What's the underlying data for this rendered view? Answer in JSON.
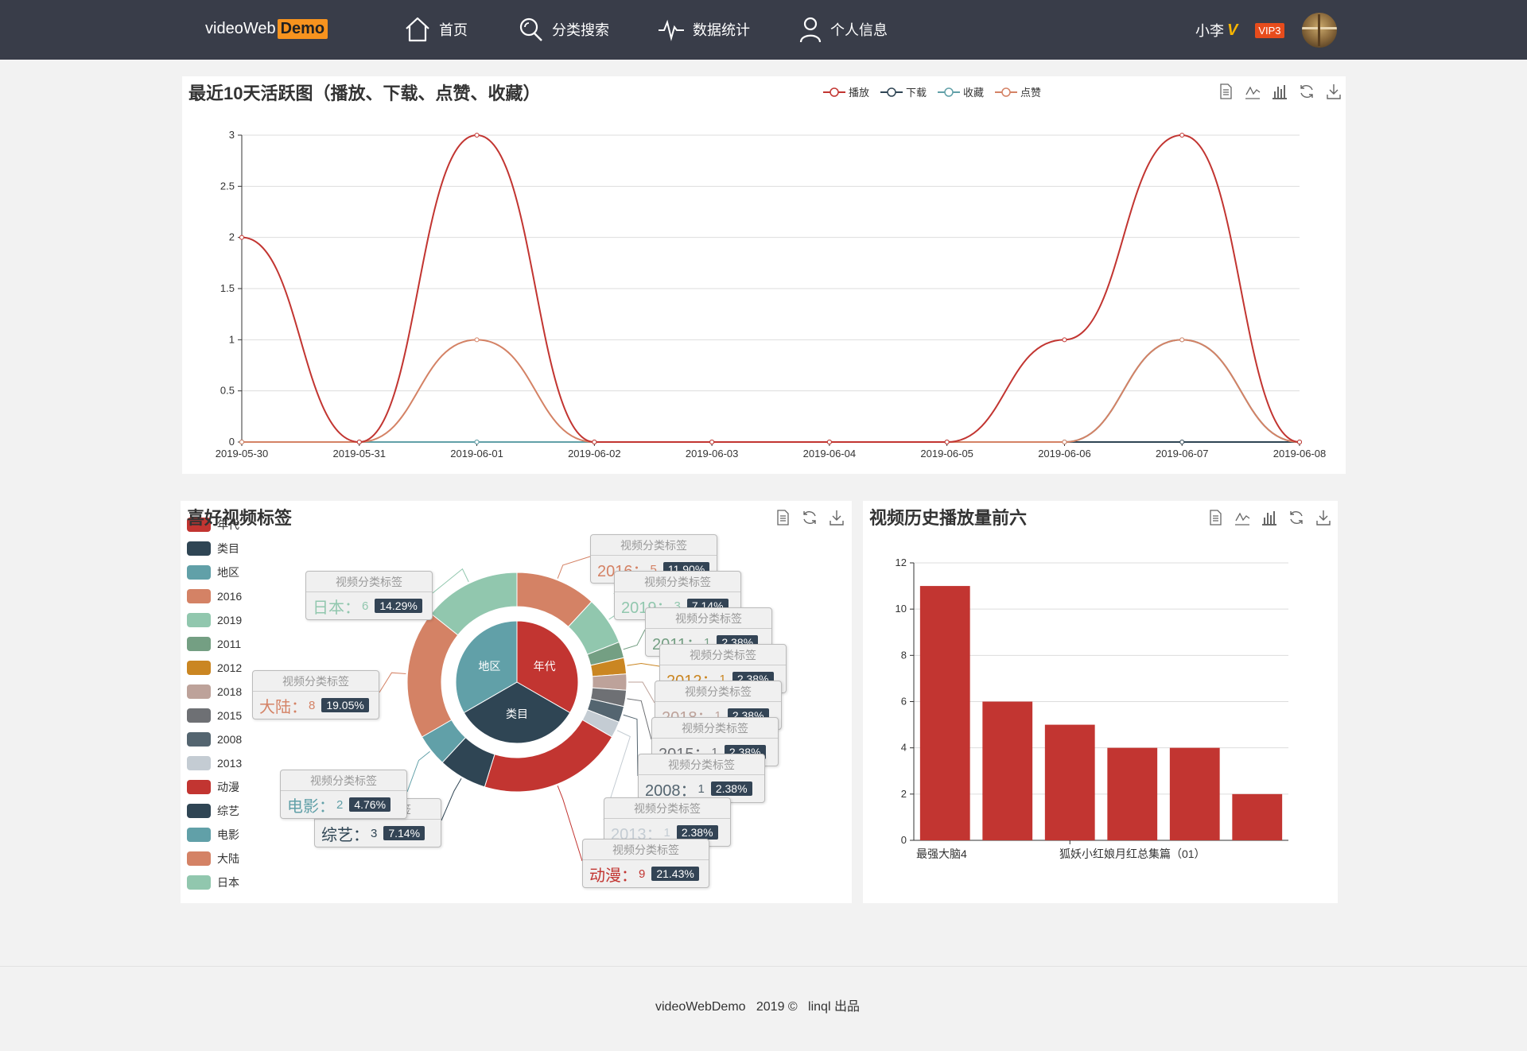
{
  "nav": {
    "brand": "videoWeb",
    "brand_badge": "Demo",
    "items": [
      {
        "label": "首页",
        "icon": "home-icon"
      },
      {
        "label": "分类搜索",
        "icon": "search-icon"
      },
      {
        "label": "数据统计",
        "icon": "pulse-icon"
      },
      {
        "label": "个人信息",
        "icon": "user-icon"
      }
    ],
    "user": {
      "name": "小李",
      "vmark": "V",
      "vip": "VIP3"
    }
  },
  "activity_panel": {
    "title": "最近10天活跃图（播放、下载、点赞、收藏）"
  },
  "tags_panel": {
    "title": "喜好视频标签"
  },
  "top_panel": {
    "title": "视频历史播放量前六"
  },
  "footer": {
    "text": "videoWebDemo   2019 ©   linql 出品"
  },
  "chart_data": [
    {
      "type": "line",
      "title": "最近10天活跃图（播放、下载、点赞、收藏）",
      "x": [
        "2019-05-30",
        "2019-05-31",
        "2019-06-01",
        "2019-06-02",
        "2019-06-03",
        "2019-06-04",
        "2019-06-05",
        "2019-06-06",
        "2019-06-07",
        "2019-06-08"
      ],
      "ylim": [
        0,
        3
      ],
      "yticks": [
        "0",
        "0.5",
        "1",
        "1.5",
        "2",
        "2.5",
        "3"
      ],
      "smooth": true,
      "legend_position": "top-center",
      "series": [
        {
          "name": "播放",
          "color": "#c23531",
          "values": [
            2,
            0,
            3,
            0,
            0,
            0,
            0,
            1,
            3,
            0
          ]
        },
        {
          "name": "下载",
          "color": "#2f4554",
          "values": [
            0,
            0,
            0,
            0,
            0,
            0,
            0,
            0,
            0,
            0
          ]
        },
        {
          "name": "收藏",
          "color": "#61a0a8",
          "values": [
            0,
            0,
            0,
            0,
            0,
            0,
            0,
            0,
            1,
            0
          ]
        },
        {
          "name": "点赞",
          "color": "#d48265",
          "values": [
            0,
            0,
            1,
            0,
            0,
            0,
            0,
            0,
            1,
            0
          ]
        }
      ]
    },
    {
      "type": "pie",
      "title": "喜好视频标签",
      "label_header": "视频分类标签",
      "legend_position": "left",
      "legend": [
        {
          "name": "年代",
          "color": "#c23531"
        },
        {
          "name": "类目",
          "color": "#2f4554"
        },
        {
          "name": "地区",
          "color": "#61a0a8"
        },
        {
          "name": "2016",
          "color": "#d48265"
        },
        {
          "name": "2019",
          "color": "#91c7ae"
        },
        {
          "name": "2011",
          "color": "#749f83"
        },
        {
          "name": "2012",
          "color": "#ca8622"
        },
        {
          "name": "2018",
          "color": "#bda29a"
        },
        {
          "name": "2015",
          "color": "#6e7074"
        },
        {
          "name": "2008",
          "color": "#546570"
        },
        {
          "name": "2013",
          "color": "#c4ccd3"
        },
        {
          "name": "动漫",
          "color": "#c23531"
        },
        {
          "name": "综艺",
          "color": "#2f4554"
        },
        {
          "name": "电影",
          "color": "#61a0a8"
        },
        {
          "name": "大陆",
          "color": "#d48265"
        },
        {
          "name": "日本",
          "color": "#91c7ae"
        }
      ],
      "inner": [
        {
          "name": "年代",
          "value": 14,
          "color": "#c23531"
        },
        {
          "name": "类目",
          "value": 14,
          "color": "#2f4554"
        },
        {
          "name": "地区",
          "value": 14,
          "color": "#61a0a8"
        }
      ],
      "outer": [
        {
          "name": "2016",
          "value": 5,
          "pct": "11.90%",
          "color": "#d48265"
        },
        {
          "name": "2019",
          "value": 3,
          "pct": "7.14%",
          "color": "#91c7ae"
        },
        {
          "name": "2011",
          "value": 1,
          "pct": "2.38%",
          "color": "#749f83"
        },
        {
          "name": "2012",
          "value": 1,
          "pct": "2.38%",
          "color": "#ca8622"
        },
        {
          "name": "2018",
          "value": 1,
          "pct": "2.38%",
          "color": "#bda29a"
        },
        {
          "name": "2015",
          "value": 1,
          "pct": "2.38%",
          "color": "#6e7074"
        },
        {
          "name": "2008",
          "value": 1,
          "pct": "2.38%",
          "color": "#546570"
        },
        {
          "name": "2013",
          "value": 1,
          "pct": "2.38%",
          "color": "#c4ccd3"
        },
        {
          "name": "动漫",
          "value": 9,
          "pct": "21.43%",
          "color": "#c23531"
        },
        {
          "name": "综艺",
          "value": 3,
          "pct": "7.14%",
          "color": "#2f4554"
        },
        {
          "name": "电影",
          "value": 2,
          "pct": "4.76%",
          "color": "#61a0a8"
        },
        {
          "name": "大陆",
          "value": 8,
          "pct": "19.05%",
          "color": "#d48265"
        },
        {
          "name": "日本",
          "value": 6,
          "pct": "14.29%",
          "color": "#91c7ae"
        }
      ]
    },
    {
      "type": "bar",
      "title": "视频历史播放量前六",
      "categories": [
        "最强大脑4",
        "",
        "",
        "狐妖小红娘月红总集篇（01）",
        "",
        ""
      ],
      "values": [
        11,
        6,
        5,
        4,
        4,
        2
      ],
      "ylim": [
        0,
        12
      ],
      "yticks": [
        "0",
        "2",
        "4",
        "6",
        "8",
        "10",
        "12"
      ],
      "color": "#c23531"
    }
  ]
}
